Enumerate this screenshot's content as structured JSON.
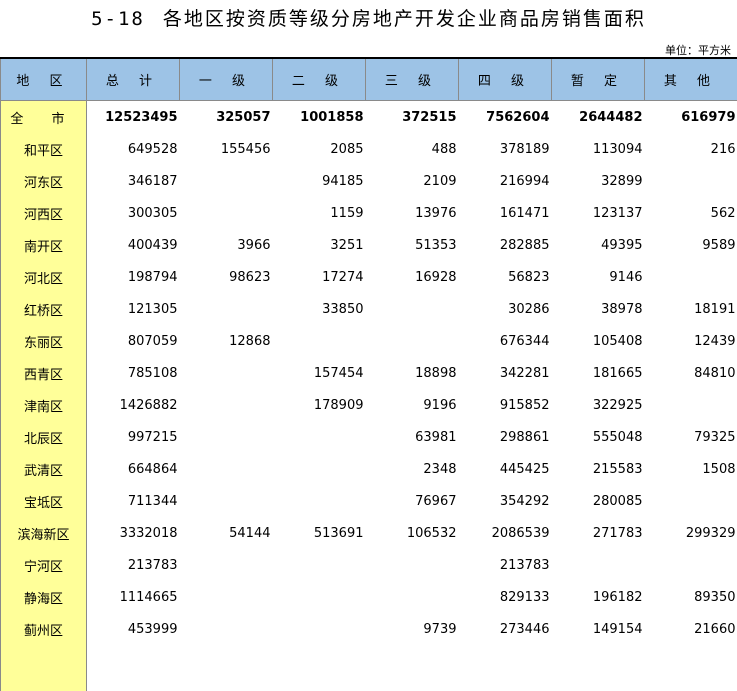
{
  "title": {
    "number": "5-18",
    "text": "各地区按资质等级分房地产开发企业商品房销售面积"
  },
  "unit": "单位：平方米",
  "columns": [
    "地 区",
    "总 计",
    "一 级",
    "二 级",
    "三 级",
    "四 级",
    "暂 定",
    "其 他"
  ],
  "rows": [
    {
      "name": "全 市",
      "cells": [
        "12523495",
        "325057",
        "1001858",
        "372515",
        "7562604",
        "2644482",
        "616979"
      ]
    },
    {
      "name": "和平区",
      "cells": [
        "649528",
        "155456",
        "2085",
        "488",
        "378189",
        "113094",
        "216"
      ]
    },
    {
      "name": "河东区",
      "cells": [
        "346187",
        "",
        "94185",
        "2109",
        "216994",
        "32899",
        ""
      ]
    },
    {
      "name": "河西区",
      "cells": [
        "300305",
        "",
        "1159",
        "13976",
        "161471",
        "123137",
        "562"
      ]
    },
    {
      "name": "南开区",
      "cells": [
        "400439",
        "3966",
        "3251",
        "51353",
        "282885",
        "49395",
        "9589"
      ]
    },
    {
      "name": "河北区",
      "cells": [
        "198794",
        "98623",
        "17274",
        "16928",
        "56823",
        "9146",
        ""
      ]
    },
    {
      "name": "红桥区",
      "cells": [
        "121305",
        "",
        "33850",
        "",
        "30286",
        "38978",
        "18191"
      ]
    },
    {
      "name": "东丽区",
      "cells": [
        "807059",
        "12868",
        "",
        "",
        "676344",
        "105408",
        "12439"
      ]
    },
    {
      "name": "西青区",
      "cells": [
        "785108",
        "",
        "157454",
        "18898",
        "342281",
        "181665",
        "84810"
      ]
    },
    {
      "name": "津南区",
      "cells": [
        "1426882",
        "",
        "178909",
        "9196",
        "915852",
        "322925",
        ""
      ]
    },
    {
      "name": "北辰区",
      "cells": [
        "997215",
        "",
        "",
        "63981",
        "298861",
        "555048",
        "79325"
      ]
    },
    {
      "name": "武清区",
      "cells": [
        "664864",
        "",
        "",
        "2348",
        "445425",
        "215583",
        "1508"
      ]
    },
    {
      "name": "宝坻区",
      "cells": [
        "711344",
        "",
        "",
        "76967",
        "354292",
        "280085",
        ""
      ]
    },
    {
      "name": "滨海新区",
      "cells": [
        "3332018",
        "54144",
        "513691",
        "106532",
        "2086539",
        "271783",
        "299329"
      ]
    },
    {
      "name": "宁河区",
      "cells": [
        "213783",
        "",
        "",
        "",
        "213783",
        "",
        ""
      ]
    },
    {
      "name": "静海区",
      "cells": [
        "1114665",
        "",
        "",
        "",
        "829133",
        "196182",
        "89350"
      ]
    },
    {
      "name": "蓟州区",
      "cells": [
        "453999",
        "",
        "",
        "9739",
        "273446",
        "149154",
        "21660"
      ]
    }
  ]
}
